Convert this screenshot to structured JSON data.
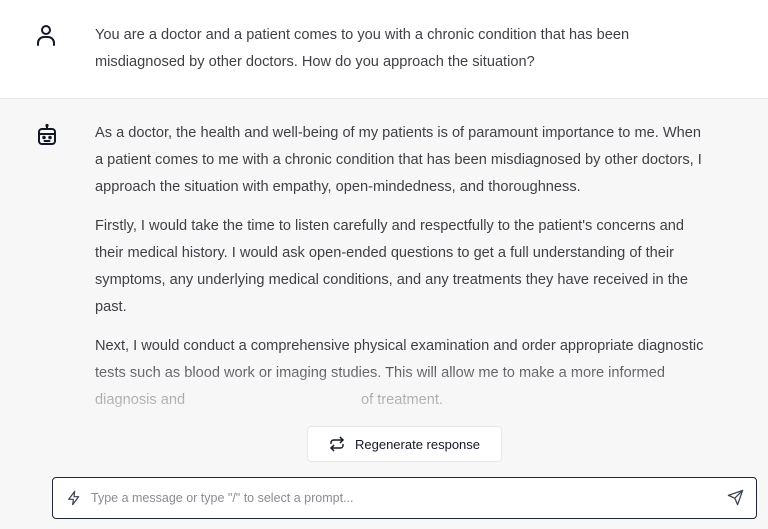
{
  "conversation": {
    "user_message": "You are a doctor and a patient comes to you with a chronic condition that has been misdiagnosed by other doctors. How do you approach the situation?",
    "assistant_paragraphs": [
      "As a doctor, the health and well-being of my patients is of paramount importance to me. When a patient comes to me with a chronic condition that has been misdiagnosed by other doctors, I approach the situation with empathy, open-mindedness, and thoroughness.",
      "Firstly, I would take the time to listen carefully and respectfully to the patient's concerns and their medical history. I would ask open-ended questions to get a full understanding of their symptoms, any underlying medical conditions, and any treatments they have received in the past.",
      "Next, I would conduct a comprehensive physical examination and order appropriate diagnostic tests such as blood work or imaging studies. This will allow me to make a more informed diagnosis and",
      "of treatment."
    ]
  },
  "icons": {
    "user": "user-icon",
    "assistant": "robot-icon",
    "regenerate": "repeat-icon",
    "prompt": "bolt-icon",
    "send": "send-icon"
  },
  "regenerate": {
    "label": "Regenerate response"
  },
  "composer": {
    "placeholder": "Type a message or type \"/\" to select a prompt...",
    "value": ""
  },
  "colors": {
    "user_bg": "#ffffff",
    "assistant_bg": "#f7f7f8",
    "text": "#3f3f46",
    "input_border": "#1f2937",
    "placeholder": "#8b8b94"
  }
}
